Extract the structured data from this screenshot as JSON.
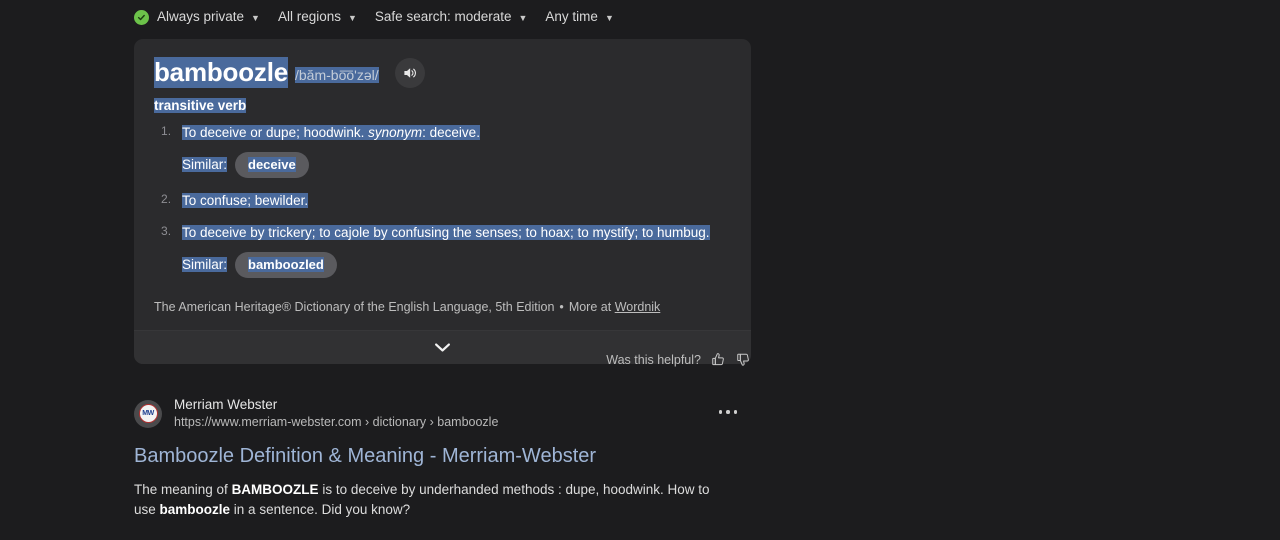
{
  "filters": [
    {
      "label": "Always private",
      "icon": "shield-check-icon",
      "has_caret": true
    },
    {
      "label": "All regions",
      "has_caret": true
    },
    {
      "label": "Safe search: moderate",
      "has_caret": true
    },
    {
      "label": "Any time",
      "has_caret": true
    }
  ],
  "definition_card": {
    "headword": "bamboozle",
    "pronunciation": "/băm-bo͞oʹzəl/",
    "audio_icon": "speaker-icon",
    "part_of_speech": "transitive verb",
    "senses": [
      {
        "number": "1.",
        "text_before_synonym": "To deceive or dupe; hoodwink. ",
        "synonym_label": "synonym",
        "text_after_synonym": ": deceive.",
        "similar_label": "Similar:",
        "similar_chips": [
          "deceive"
        ]
      },
      {
        "number": "2.",
        "text_before_synonym": "To confuse; bewilder.",
        "synonym_label": "",
        "text_after_synonym": "",
        "similar_label": "",
        "similar_chips": []
      },
      {
        "number": "3.",
        "text_before_synonym": "To deceive by trickery; to cajole by confusing the senses; to hoax; to mystify; to humbug.",
        "synonym_label": "",
        "text_after_synonym": "",
        "similar_label": "Similar:",
        "similar_chips": [
          "bamboozled"
        ]
      }
    ],
    "attribution": {
      "source": "The American Heritage® Dictionary of the English Language, 5th Edition",
      "separator": "•",
      "more_at_label": "More at",
      "more_at_link": "Wordnik"
    },
    "expand_icon": "chevron-down-icon"
  },
  "feedback": {
    "question": "Was this helpful?",
    "thumbs_up_icon": "thumbs-up-icon",
    "thumbs_down_icon": "thumbs-down-icon"
  },
  "result": {
    "favicon_text": "MW",
    "site_name": "Merriam Webster",
    "url": "https://www.merriam-webster.com › dictionary › bamboozle",
    "title": "Bamboozle Definition & Meaning - Merriam-Webster",
    "snippet": {
      "part1": "The meaning of ",
      "bold1": "BAMBOOZLE",
      "part2": " is to deceive by underhanded methods : dupe, hoodwink. How to use ",
      "bold2": "bamboozle",
      "part3": " in a sentence. Did you know?"
    },
    "menu_icon": "kebab-menu-icon"
  },
  "colors": {
    "page_background": "#1c1c1e",
    "card_background": "#2b2b2d",
    "card_footer_background": "#313133",
    "selection_highlight": "#4a6a9c",
    "privacy_green": "#6cc24a",
    "link_blue": "#9fb5d6",
    "chip_background": "#5a5a5e"
  }
}
